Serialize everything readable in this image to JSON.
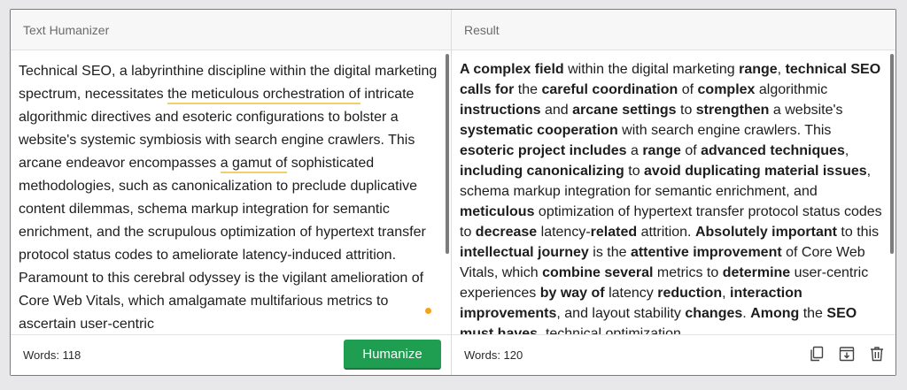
{
  "left_pane": {
    "title": "Text Humanizer",
    "text_segments": [
      {
        "text": "Technical SEO, a labyrinthine discipline within the digital marketing spectrum, necessitates ",
        "highlight": false
      },
      {
        "text": "the meticulous orchestration of",
        "highlight": true
      },
      {
        "text": " intricate algorithmic directives and esoteric configurations to bolster a website's systemic symbiosis with search engine crawlers. This arcane endeavor encompasses ",
        "highlight": false
      },
      {
        "text": "a gamut of",
        "highlight": true
      },
      {
        "text": " sophisticated methodologies, such as canonicalization to preclude duplicative content dilemmas, schema markup integration for semantic enrichment, and the scrupulous optimization of hypertext transfer protocol status codes to ameliorate latency-induced attrition. Paramount to this cerebral odyssey is the vigilant amelioration of Core Web Vitals, which amalgamate multifarious metrics to ascertain user-centric",
        "highlight": false
      }
    ],
    "word_count": "Words: 118",
    "humanize_label": "Humanize"
  },
  "right_pane": {
    "title": "Result",
    "segments": [
      {
        "t": "A complex field",
        "b": true
      },
      {
        "t": " within the digital marketing ",
        "b": false
      },
      {
        "t": "range",
        "b": true
      },
      {
        "t": ", ",
        "b": false
      },
      {
        "t": "technical SEO calls for",
        "b": true
      },
      {
        "t": " the ",
        "b": false
      },
      {
        "t": "careful coordination",
        "b": true
      },
      {
        "t": " of ",
        "b": false
      },
      {
        "t": "complex",
        "b": true
      },
      {
        "t": " algorithmic ",
        "b": false
      },
      {
        "t": "instructions",
        "b": true
      },
      {
        "t": " and ",
        "b": false
      },
      {
        "t": "arcane settings",
        "b": true
      },
      {
        "t": " to ",
        "b": false
      },
      {
        "t": "strengthen",
        "b": true
      },
      {
        "t": " a website's ",
        "b": false
      },
      {
        "t": "systematic cooperation",
        "b": true
      },
      {
        "t": " with search engine crawlers. This ",
        "b": false
      },
      {
        "t": "esoteric project includes",
        "b": true
      },
      {
        "t": " a ",
        "b": false
      },
      {
        "t": "range",
        "b": true
      },
      {
        "t": " of ",
        "b": false
      },
      {
        "t": "advanced techniques",
        "b": true
      },
      {
        "t": ", ",
        "b": false
      },
      {
        "t": "including canonicalizing",
        "b": true
      },
      {
        "t": " to ",
        "b": false
      },
      {
        "t": "avoid duplicating material issues",
        "b": true
      },
      {
        "t": ", schema markup integration for semantic enrichment, and ",
        "b": false
      },
      {
        "t": "meticulous",
        "b": true
      },
      {
        "t": " optimization of hypertext transfer protocol status codes to ",
        "b": false
      },
      {
        "t": "decrease",
        "b": true
      },
      {
        "t": " latency-",
        "b": false
      },
      {
        "t": "related",
        "b": true
      },
      {
        "t": " attrition. ",
        "b": false
      },
      {
        "t": "Absolutely important",
        "b": true
      },
      {
        "t": " to this ",
        "b": false
      },
      {
        "t": "intellectual journey",
        "b": true
      },
      {
        "t": " is the ",
        "b": false
      },
      {
        "t": "attentive improvement",
        "b": true
      },
      {
        "t": " of Core Web Vitals, which ",
        "b": false
      },
      {
        "t": "combine several",
        "b": true
      },
      {
        "t": " metrics to ",
        "b": false
      },
      {
        "t": "determine",
        "b": true
      },
      {
        "t": " user-centric experiences ",
        "b": false
      },
      {
        "t": "by way of",
        "b": true
      },
      {
        "t": " latency ",
        "b": false
      },
      {
        "t": "reduction",
        "b": true
      },
      {
        "t": ", ",
        "b": false
      },
      {
        "t": "interaction improvements",
        "b": true
      },
      {
        "t": ", and layout stability ",
        "b": false
      },
      {
        "t": "changes",
        "b": true
      },
      {
        "t": ". ",
        "b": false
      },
      {
        "t": "Among",
        "b": true
      },
      {
        "t": " the ",
        "b": false
      },
      {
        "t": "SEO must haves",
        "b": true
      },
      {
        "t": ", technical optimization",
        "b": false
      }
    ],
    "word_count": "Words: 120",
    "icons": [
      "copy-icon",
      "download-icon",
      "trash-icon"
    ]
  },
  "colors": {
    "humanize_button": "#1f9e51",
    "highlight_underline": "#f1cf6a",
    "indicator_dot": "#f5a31a"
  }
}
